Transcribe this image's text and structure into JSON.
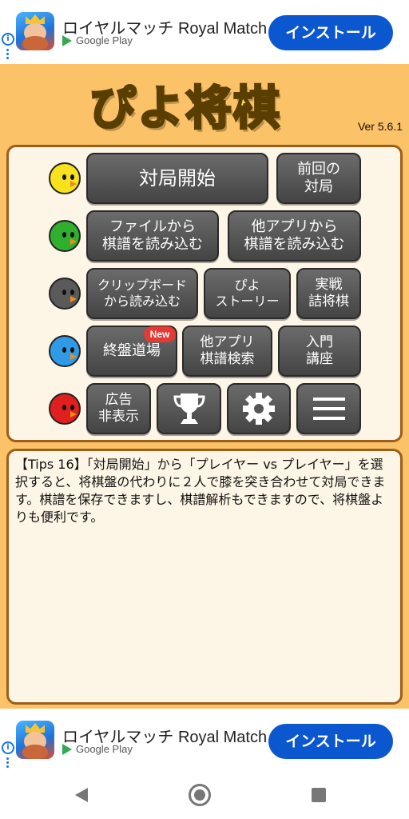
{
  "ad_top": {
    "title": "ロイヤルマッチ Royal Match",
    "store": "Google Play",
    "install": "インストール",
    "info": "i"
  },
  "ad_bottom": {
    "title": "ロイヤルマッチ Royal Match",
    "store": "Google Play",
    "install": "インストール",
    "info": "i"
  },
  "header": {
    "logo": "ぴよ将棋",
    "version": "Ver 5.6.1"
  },
  "menu": {
    "start_game": "対局開始",
    "previous_game": "前回の\n対局",
    "load_file": "ファイルから\n棋譜を読み込む",
    "load_other_app": "他アプリから\n棋譜を読み込む",
    "load_clipboard": "クリップボード\nから読み込む",
    "piyo_story": "ぴよ\nストーリー",
    "tsume_shogi": "実戦\n詰将棋",
    "endgame_dojo": "終盤道場",
    "new_badge": "New",
    "other_app_search": "他アプリ\n棋譜検索",
    "intro_lessons": "入門\n講座",
    "hide_ads": "広告\n非表示"
  },
  "birds": [
    {
      "color": "#f7e21b",
      "name": "yellow"
    },
    {
      "color": "#2fae2f",
      "name": "green"
    },
    {
      "color": "#5a5a5a",
      "name": "gray"
    },
    {
      "color": "#2f9be6",
      "name": "blue"
    },
    {
      "color": "#e01f1f",
      "name": "red"
    }
  ],
  "tips": {
    "text": "【Tips 16】「対局開始」から「プレイヤー vs プレイヤー」を選択すると、将棋盤の代わりに２人で膝を突き合わせて対局できます。棋譜を保存できますし、棋譜解析もできますので、将棋盤よりも便利です。"
  },
  "icons": {
    "trophy": "trophy-icon",
    "settings": "gear-icon",
    "menu": "hamburger-menu-icon"
  }
}
